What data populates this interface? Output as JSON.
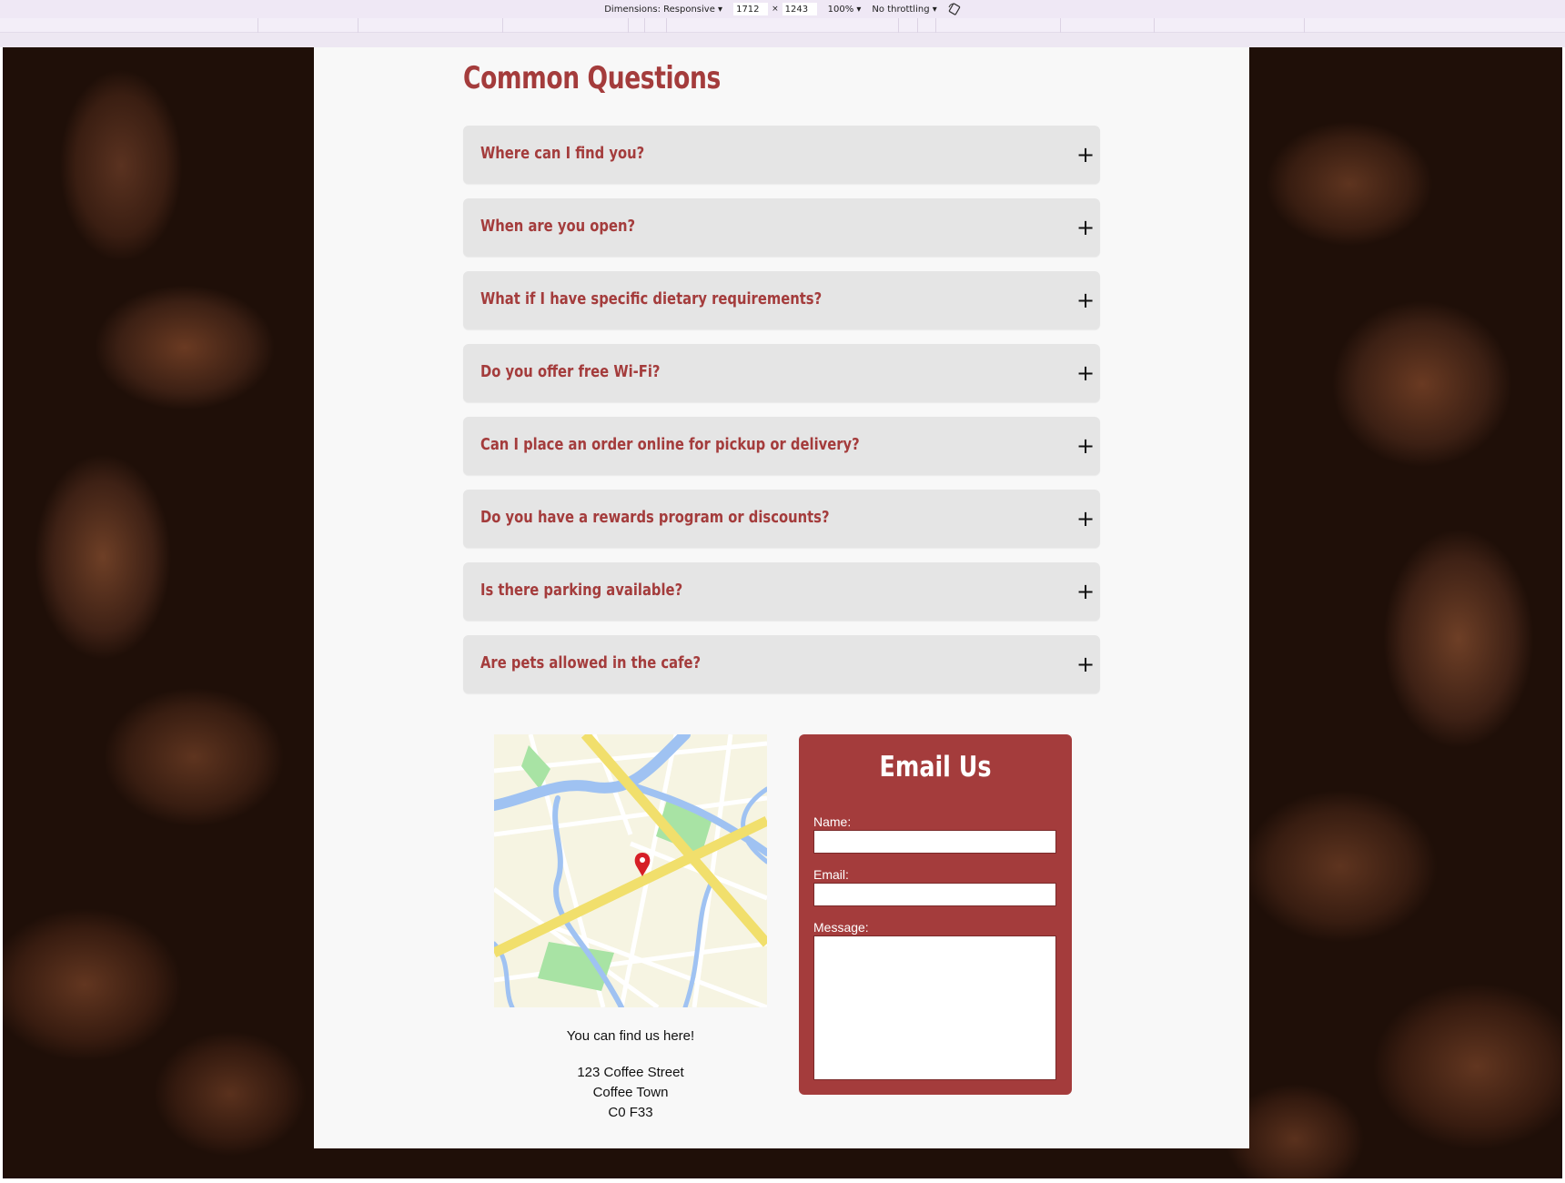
{
  "devtools": {
    "dimensions_label": "Dimensions: Responsive",
    "width_value": "1712",
    "times": "×",
    "height_value": "1243",
    "zoom": "100%",
    "throttling": "No throttling"
  },
  "faq": {
    "title": "Common Questions",
    "items": [
      {
        "question": "Where can I find you?",
        "toggle": "+"
      },
      {
        "question": "When are you open?",
        "toggle": "+"
      },
      {
        "question": "What if I have specific dietary requirements?",
        "toggle": "+"
      },
      {
        "question": "Do you offer free Wi-Fi?",
        "toggle": "+"
      },
      {
        "question": "Can I place an order online for pickup or delivery?",
        "toggle": "+"
      },
      {
        "question": "Do you have a rewards program or discounts?",
        "toggle": "+"
      },
      {
        "question": "Is there parking available?",
        "toggle": "+"
      },
      {
        "question": "Are pets allowed in the cafe?",
        "toggle": "+"
      }
    ]
  },
  "location": {
    "find_text": "You can find us here!",
    "address_line1": "123 Coffee Street",
    "address_line2": "Coffee Town",
    "address_line3": "C0 F33"
  },
  "email_form": {
    "title": "Email Us",
    "name_label": "Name:",
    "email_label": "Email:",
    "message_label": "Message:"
  },
  "colors": {
    "accent": "#a43c3c",
    "faq_bg": "#e5e5e5",
    "content_bg": "#f8f8f8",
    "map_road": "#f1df6c",
    "map_water": "#9fc2f2",
    "map_park": "#a8e3a4",
    "map_pin": "#d61f26"
  }
}
